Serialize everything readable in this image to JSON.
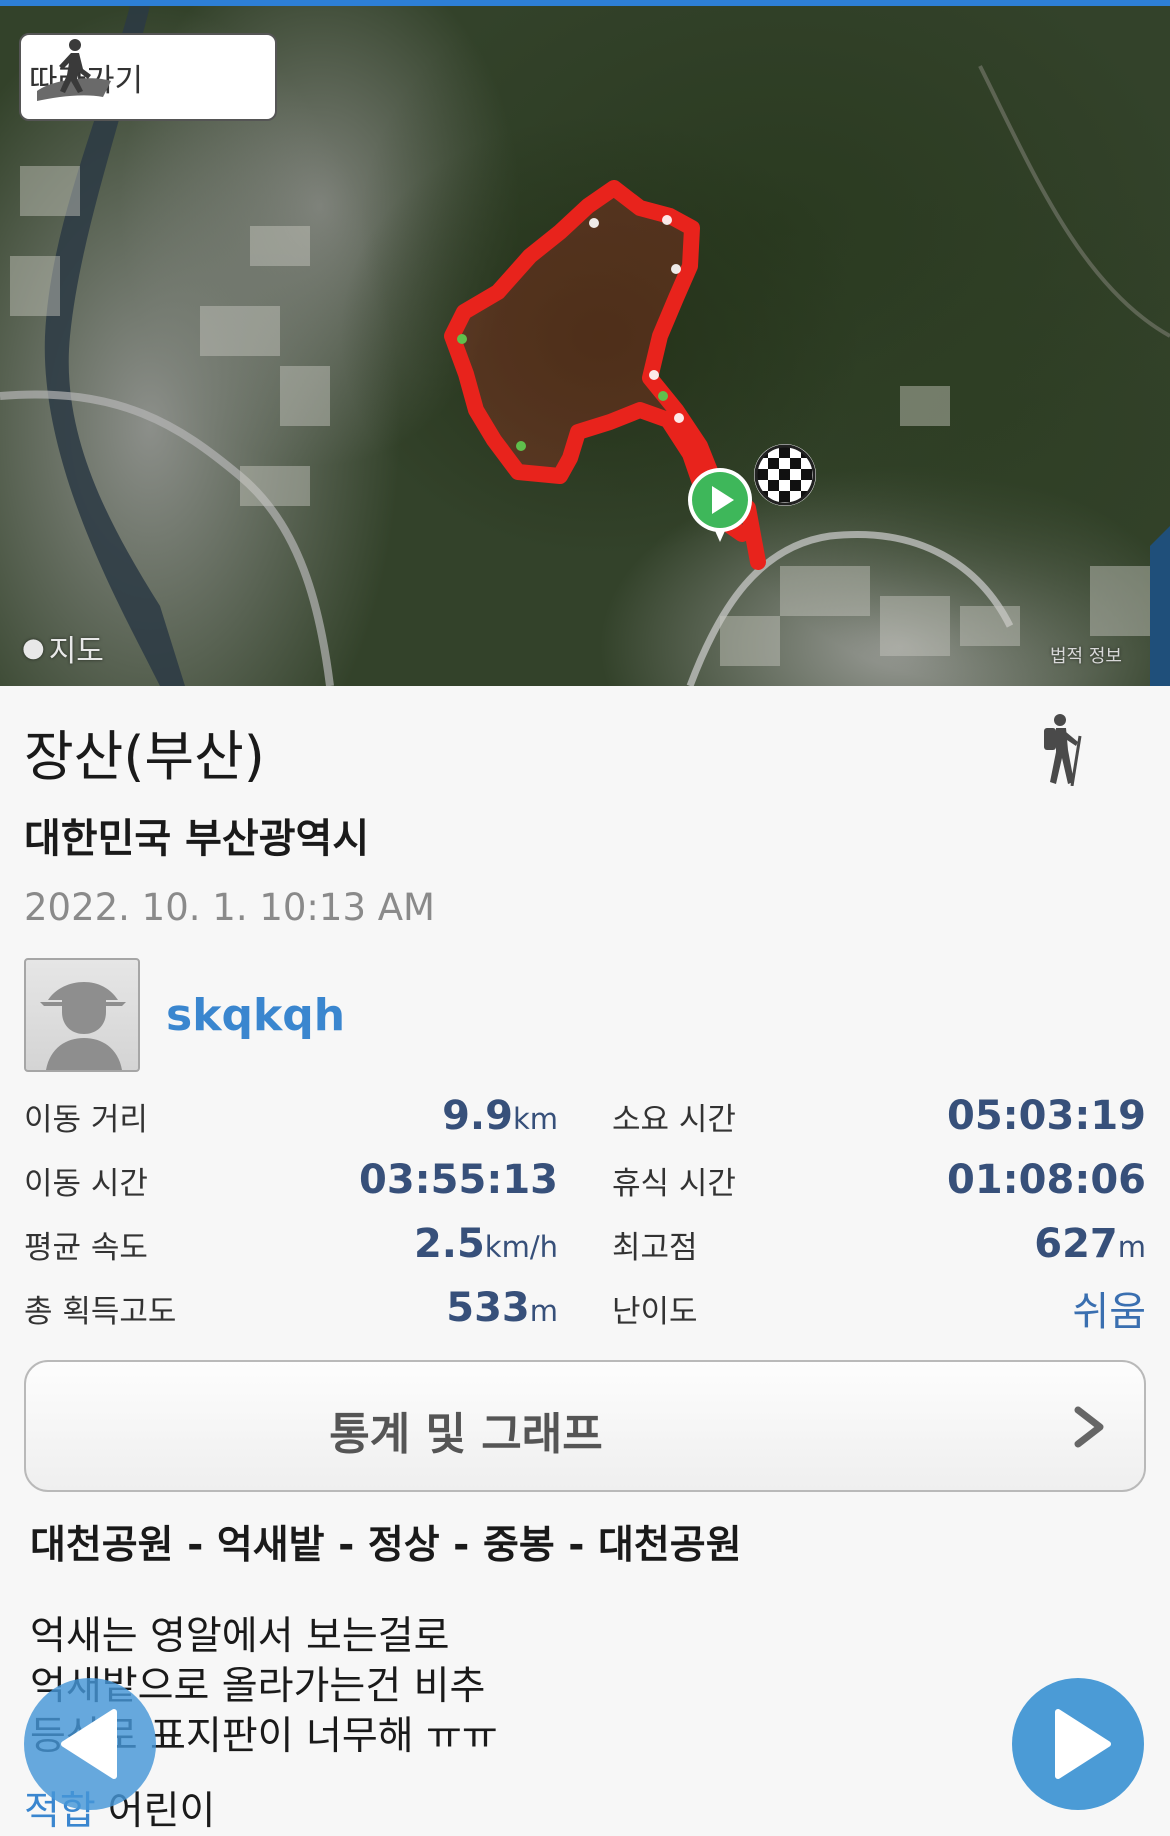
{
  "map": {
    "follow_label": "따라가기",
    "credit": "지도",
    "legal": "법적 정보",
    "icons": [
      "walker-icon",
      "apple-logo-icon",
      "start-marker-icon",
      "finish-flag-icon"
    ],
    "route_color": "#e8231c"
  },
  "trip": {
    "title": "장산(부산)",
    "location": "대한민국 부산광역시",
    "datetime": "2022. 10. 1. 10:13 AM",
    "activity_icon": "hiker-icon"
  },
  "user": {
    "name": "skqkqh",
    "avatar_icon": "default-avatar-icon"
  },
  "stats": {
    "distance": {
      "label": "이동 거리",
      "value": "9.9",
      "unit": "km"
    },
    "total_time": {
      "label": "소요 시간",
      "value": "05:03:19",
      "unit": ""
    },
    "moving_time": {
      "label": "이동 시간",
      "value": "03:55:13",
      "unit": ""
    },
    "rest_time": {
      "label": "휴식 시간",
      "value": "01:08:06",
      "unit": ""
    },
    "avg_speed": {
      "label": "평균 속도",
      "value": "2.5",
      "unit": "km/h"
    },
    "max_elevation": {
      "label": "최고점",
      "value": "627",
      "unit": "m"
    },
    "total_ascent": {
      "label": "총 획득고도",
      "value": "533",
      "unit": "m"
    },
    "difficulty": {
      "label": "난이도",
      "value": "쉬움",
      "unit": ""
    }
  },
  "graph_button": {
    "label": "통계 및 그래프",
    "icon": "chevron-right-icon"
  },
  "route_summary": "대천공원 - 억새밭 - 정상 - 중봉 - 대천공원",
  "memo_lines": [
    "억새는 영알에서 보는걸로",
    "억새밭으로 올라가는건 비추",
    "등산로 표지판이 너무해 ㅠㅠ"
  ],
  "tag": {
    "label": "적합",
    "value": "어린이"
  },
  "nav": {
    "prev_icon": "play-left-icon",
    "next_icon": "play-right-icon"
  }
}
